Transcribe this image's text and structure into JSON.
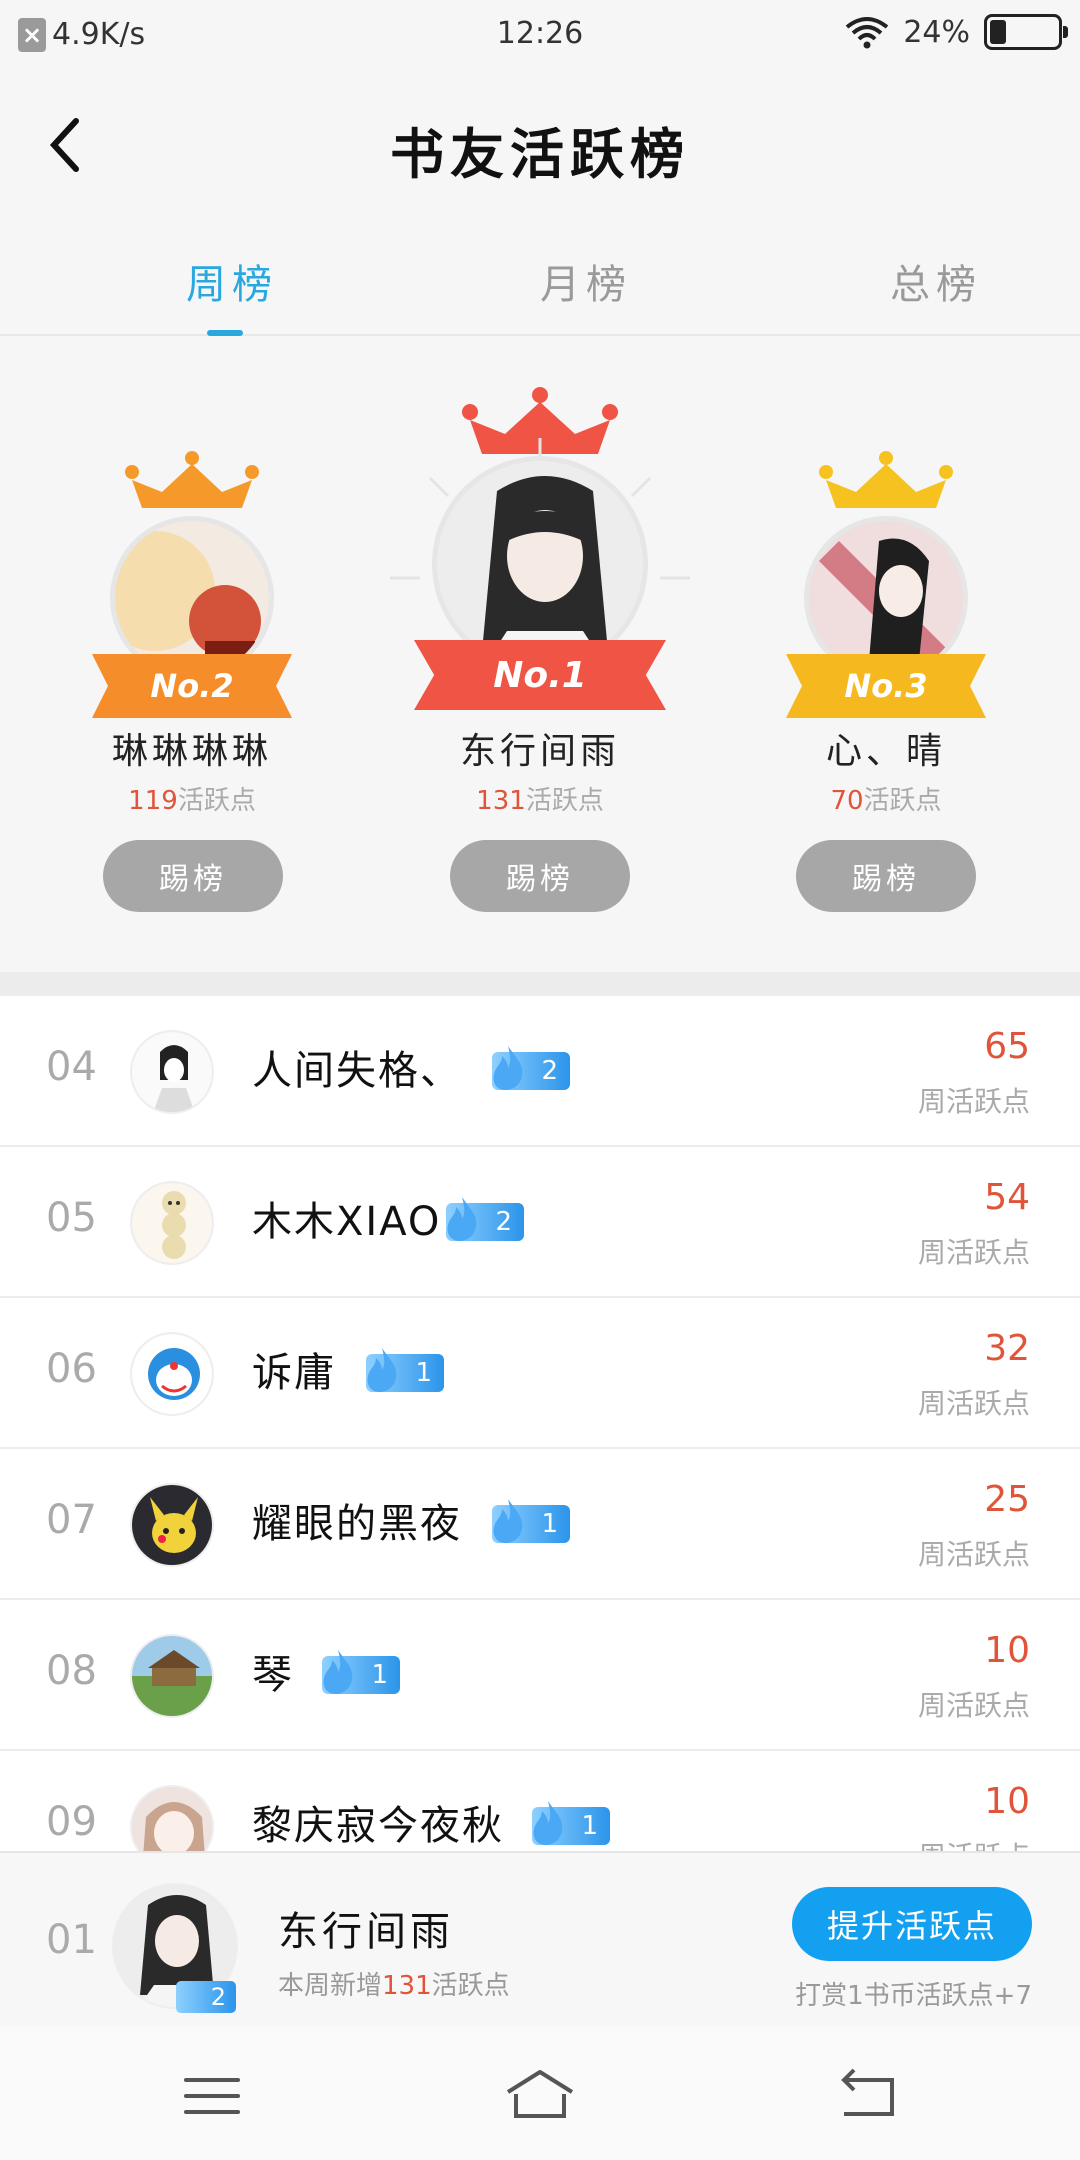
{
  "status_bar": {
    "speed": "4.9K/s",
    "time": "12:26",
    "battery": "24%",
    "battery_level": 0.24
  },
  "header": {
    "title": "书友活跃榜"
  },
  "tabs": [
    {
      "label": "周榜",
      "active": true
    },
    {
      "label": "月榜",
      "active": false
    },
    {
      "label": "总榜",
      "active": false
    }
  ],
  "podium": {
    "first": {
      "badge": "No.1",
      "name": "东行间雨",
      "points": "131",
      "points_suffix": "活跃点",
      "button": "踢榜",
      "ribbon_color": "#ef5444",
      "crown_color": "#ef5444"
    },
    "second": {
      "badge": "No.2",
      "name": "琳琳琳琳",
      "points": "119",
      "points_suffix": "活跃点",
      "button": "踢榜",
      "ribbon_color": "#f58e2a",
      "crown_color": "#f59a2a"
    },
    "third": {
      "badge": "No.3",
      "name": "心、晴",
      "points": "70",
      "points_suffix": "活跃点",
      "button": "踢榜",
      "ribbon_color": "#f6b81f",
      "crown_color": "#f6c21f"
    }
  },
  "list": {
    "points_label": "周活跃点",
    "rows": [
      {
        "rank": "04",
        "name": "人间失格、",
        "level": "2",
        "points": "65"
      },
      {
        "rank": "05",
        "name": "木木XIAO",
        "level": "2",
        "points": "54"
      },
      {
        "rank": "06",
        "name": "诉庸",
        "level": "1",
        "points": "32"
      },
      {
        "rank": "07",
        "name": "耀眼的黑夜",
        "level": "1",
        "points": "25"
      },
      {
        "rank": "08",
        "name": "琴",
        "level": "1",
        "points": "10"
      },
      {
        "rank": "09",
        "name": "黎庆寂今夜秋",
        "level": "1",
        "points": "10"
      }
    ]
  },
  "me": {
    "rank": "01",
    "name": "东行间雨",
    "level": "2",
    "sub_prefix": "本周新增",
    "sub_points": "131",
    "sub_suffix": "活跃点",
    "boost_button": "提升活跃点",
    "reward_text": "打赏1书币活跃点+7"
  },
  "colors": {
    "accent": "#29a8e0",
    "points": "#e0553a",
    "button_blue": "#13a0f0"
  }
}
